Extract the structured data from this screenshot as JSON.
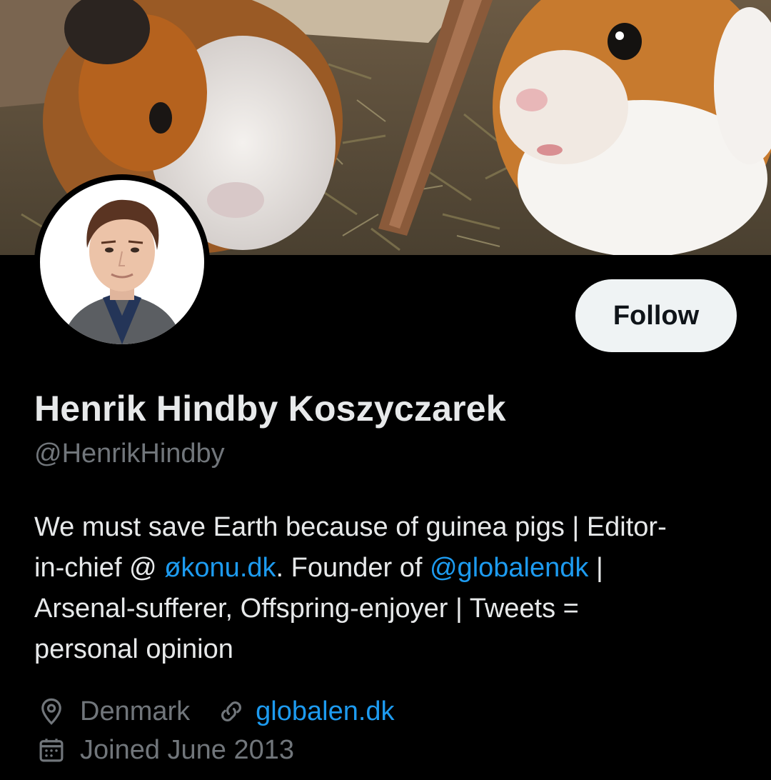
{
  "profile": {
    "display_name": "Henrik Hindby Koszyczarek",
    "handle": "@HenrikHindby",
    "follow_label": "Follow",
    "bio": {
      "line1": "We must save Earth because of guinea pigs | Editor-",
      "line2_pre": "in-chief @ ",
      "line2_link1": "økonu.dk",
      "line2_mid": ". Founder of ",
      "line2_link2": "@globalendk",
      "line2_post": " |",
      "line3": "Arsenal-sufferer, Offspring-enjoyer | Tweets =",
      "line4": "personal opinion"
    },
    "location": "Denmark",
    "website": "globalen.dk",
    "joined": "Joined June 2013"
  },
  "icons": {
    "location": "location-pin-icon",
    "link": "link-icon",
    "calendar": "calendar-icon"
  },
  "colors": {
    "background": "#000000",
    "text": "#e7e9ea",
    "secondary": "#71767b",
    "link": "#1d9bf0",
    "follow_bg": "#eff3f4"
  }
}
